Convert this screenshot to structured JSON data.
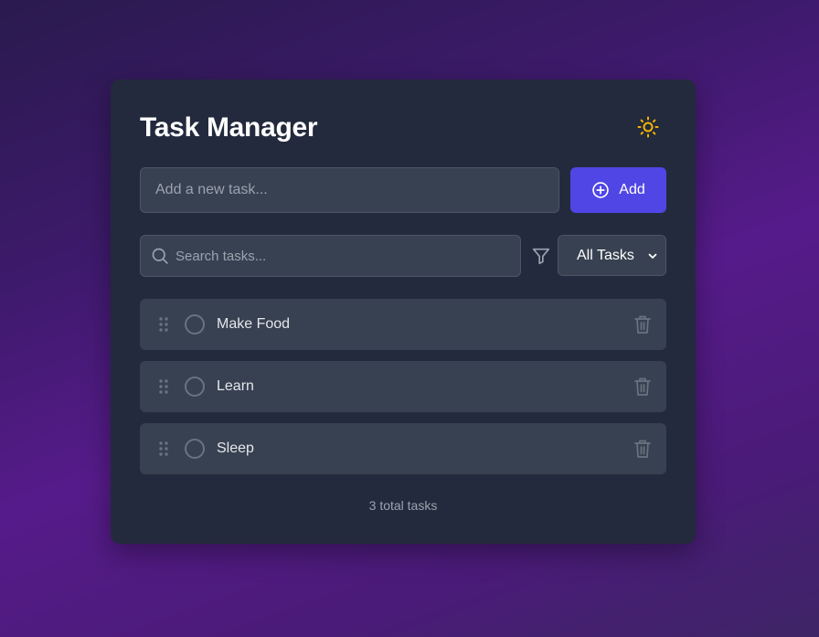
{
  "app": {
    "title": "Task Manager",
    "theme_icon": "sun-icon"
  },
  "colors": {
    "accent": "#4f46e5",
    "card_bg": "#232a3d",
    "field_bg": "#374151",
    "sun": "#f5b400"
  },
  "new_task": {
    "placeholder": "Add a new task...",
    "value": "",
    "add_label": "Add",
    "add_icon": "plus-circle-icon"
  },
  "search": {
    "placeholder": "Search tasks...",
    "value": "",
    "icon": "search-icon"
  },
  "filter": {
    "icon": "filter-icon",
    "selected": "All Tasks"
  },
  "tasks": [
    {
      "label": "Make Food",
      "completed": false
    },
    {
      "label": "Learn",
      "completed": false
    },
    {
      "label": "Sleep",
      "completed": false
    }
  ],
  "footer": {
    "count_text": "3 total tasks"
  }
}
